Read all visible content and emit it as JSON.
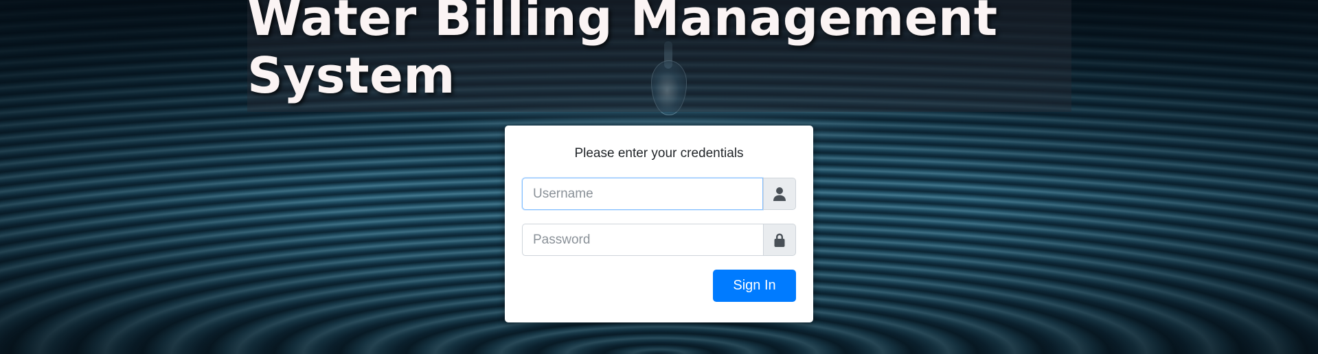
{
  "header": {
    "title": "Water Billing Management System"
  },
  "login": {
    "prompt": "Please enter your credentials",
    "username": {
      "value": "",
      "placeholder": "Username",
      "icon": "user-icon"
    },
    "password": {
      "value": "",
      "placeholder": "Password",
      "icon": "lock-icon"
    },
    "submit_label": "Sign In"
  },
  "colors": {
    "primary": "#007bff",
    "title_text": "#fbf4f4",
    "addon_bg": "#e9ecef"
  }
}
